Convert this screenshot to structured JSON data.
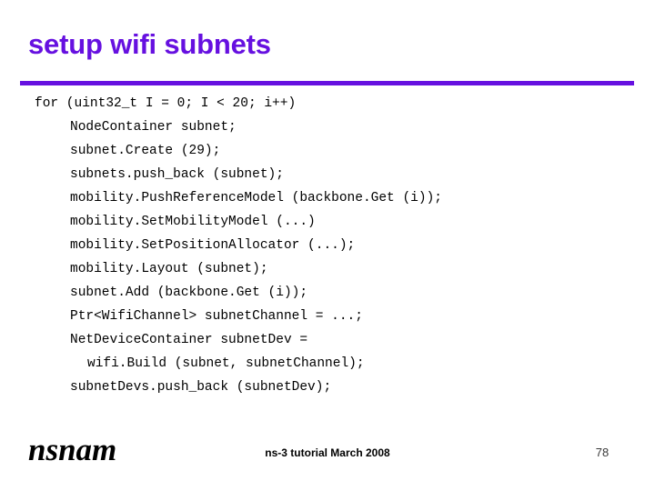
{
  "slide": {
    "title": "setup wifi subnets",
    "title_color": "#6610e0",
    "rule_color": "#6610e0",
    "background_color": "#ffffff",
    "code_lines": [
      {
        "text": "for (uint32_t I = 0; I < 20; i++)",
        "indent": 0
      },
      {
        "text": "NodeContainer subnet;",
        "indent": 1
      },
      {
        "text": "subnet.Create (29);",
        "indent": 1
      },
      {
        "text": "subnets.push_back (subnet);",
        "indent": 1
      },
      {
        "text": "mobility.PushReferenceModel (backbone.Get (i));",
        "indent": 1
      },
      {
        "text": "mobility.SetMobilityModel (...)",
        "indent": 1
      },
      {
        "text": "mobility.SetPositionAllocator (...);",
        "indent": 1
      },
      {
        "text": "mobility.Layout (subnet);",
        "indent": 1
      },
      {
        "text": "subnet.Add (backbone.Get (i));",
        "indent": 1
      },
      {
        "text": "Ptr<WifiChannel> subnetChannel = ...;",
        "indent": 1
      },
      {
        "text": "NetDeviceContainer subnetDev =",
        "indent": 1
      },
      {
        "text": "wifi.Build (subnet, subnetChannel);",
        "indent": 2
      },
      {
        "text": "subnetDevs.push_back (subnetDev);",
        "indent": 1
      }
    ]
  },
  "footer": {
    "logo": "nsnam",
    "center_text": "ns-3 tutorial March 2008",
    "page_number": "78"
  }
}
